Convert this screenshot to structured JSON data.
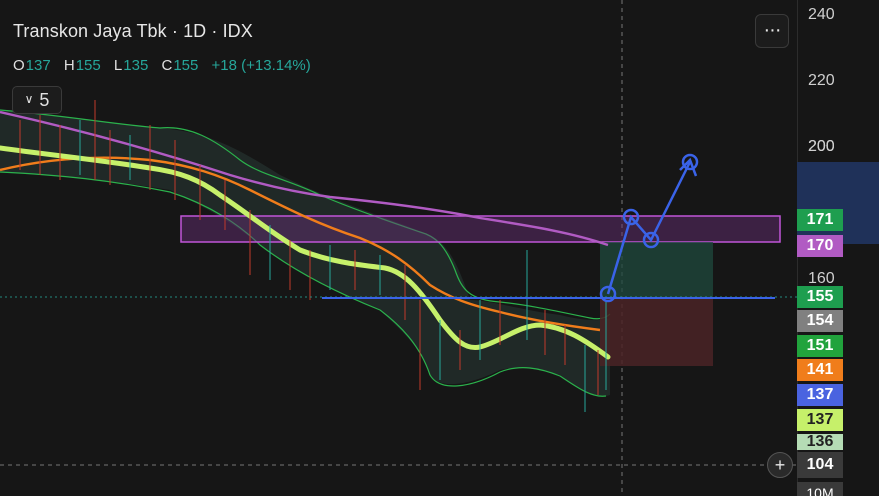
{
  "header": {
    "title": "Transkon Jaya Tbk · 1D · IDX",
    "ohlc": [
      {
        "key": "O",
        "value": "137"
      },
      {
        "key": "H",
        "value": "155"
      },
      {
        "key": "L",
        "value": "135"
      },
      {
        "key": "C",
        "value": "155"
      }
    ],
    "change": "+18 (+13.14%)",
    "collapse_label": "5",
    "menu_label": "···"
  },
  "price_axis": {
    "ticks": [
      "240",
      "220",
      "200",
      "160"
    ],
    "tags": [
      {
        "value": "171",
        "color": "#1e9e4f"
      },
      {
        "value": "170",
        "color": "#b15bc3"
      },
      {
        "value": "155",
        "color": "#1e9e4f"
      },
      {
        "value": "154",
        "color": "#808080"
      },
      {
        "value": "151",
        "color": "#21a33c"
      },
      {
        "value": "141",
        "color": "#f07d1b"
      },
      {
        "value": "137",
        "color": "#4a63e0"
      },
      {
        "value": "137",
        "color": "#c6f06a"
      },
      {
        "value": "136",
        "color": "#b5dcb5"
      }
    ],
    "crosshair_value": "104",
    "volume_label": "10M"
  },
  "colors": {
    "background": "#161616",
    "up": "#26a69a",
    "ema_fast": "#c6f06a",
    "ema_slow": "#f07d1b",
    "ma_long": "#b15bc3",
    "bollinger": "#2bb24c",
    "projection": "#3a63e8"
  }
}
